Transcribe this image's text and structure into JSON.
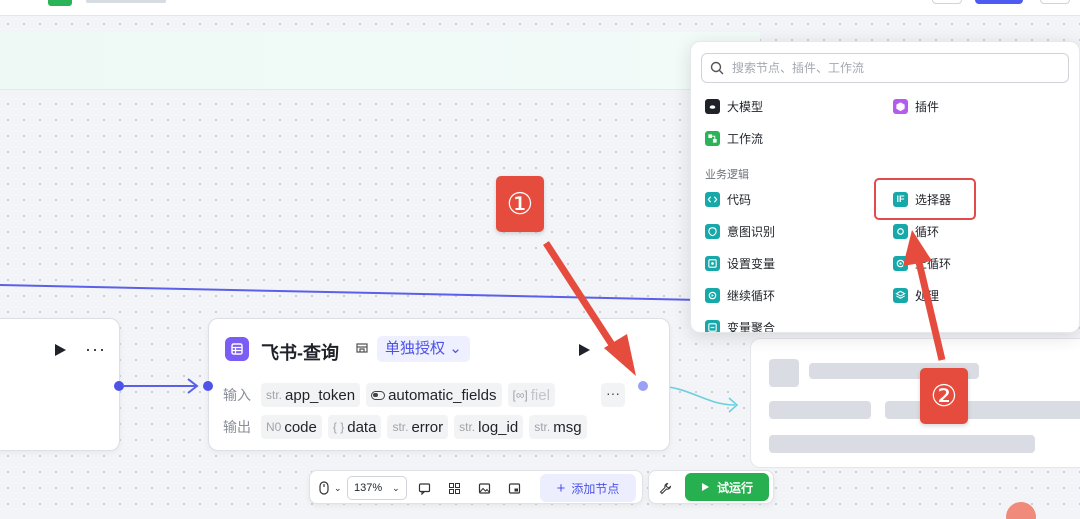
{
  "node_panel": {
    "search_placeholder": "搜索节点、插件、工作流",
    "items_top": [
      {
        "label": "大模型",
        "icon": "llm-icon",
        "color": "#1f2329"
      },
      {
        "label": "插件",
        "icon": "plugin-icon",
        "color": "#b45cf0"
      },
      {
        "label": "工作流",
        "icon": "workflow-icon",
        "color": "#2bb35a"
      }
    ],
    "section_business": "业务逻辑",
    "items_business": [
      {
        "label": "代码",
        "icon": "code-icon",
        "color": "#17a9a9"
      },
      {
        "label": "选择器",
        "icon": "if-icon",
        "color": "#17a9a9"
      },
      {
        "label": "意图识别",
        "icon": "intent-icon",
        "color": "#17a9a9"
      },
      {
        "label": "循环",
        "icon": "loop-icon",
        "color": "#17a9a9"
      },
      {
        "label": "设置变量",
        "icon": "set-variable-icon",
        "color": "#17a9a9"
      },
      {
        "label": "上循环",
        "icon": "loop-end-icon",
        "color": "#17a9a9"
      },
      {
        "label": "继续循环",
        "icon": "continue-loop-icon",
        "color": "#17a9a9"
      },
      {
        "label": "处理",
        "icon": "batch-icon",
        "color": "#17a9a9"
      },
      {
        "label": "变量聚合",
        "icon": "variable-merge-icon",
        "color": "#17a9a9"
      }
    ]
  },
  "feishu_node": {
    "title": "飞书-查询",
    "auth_label": "单独授权",
    "input_label": "输入",
    "output_label": "输出",
    "inputs": [
      {
        "type": "str.",
        "name": "app_token"
      },
      {
        "type": "",
        "name": "automatic_fields"
      },
      {
        "type": "",
        "name": "fiel"
      }
    ],
    "outputs": [
      {
        "type": "N0",
        "name": "code"
      },
      {
        "type": "{ }",
        "name": "data"
      },
      {
        "type": "str.",
        "name": "error"
      },
      {
        "type": "str.",
        "name": "log_id"
      },
      {
        "type": "str.",
        "name": "msg"
      }
    ]
  },
  "annotations": {
    "badge_1": "①",
    "badge_2": "②"
  },
  "toolbar": {
    "zoom": "137%",
    "add_node": "添加节点",
    "run": "试运行"
  },
  "colors": {
    "accent": "#4d53e8",
    "run": "#27b04f",
    "annotation": "#e64c3e"
  }
}
